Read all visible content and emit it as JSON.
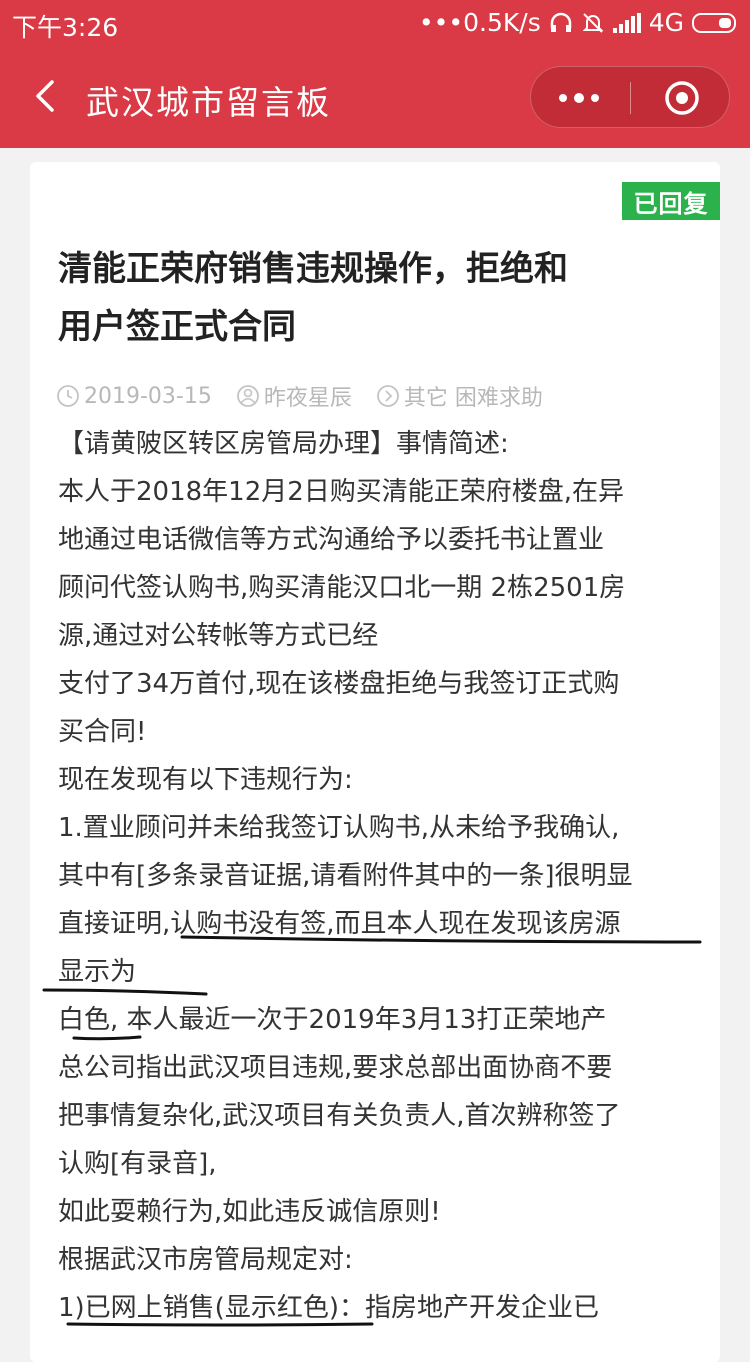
{
  "status_bar": {
    "time": "下午3:26",
    "net_speed": "•••0.5K/s",
    "network": "4G",
    "icons": [
      "headphones-icon",
      "mute-bell-icon",
      "signal-icon",
      "battery-icon"
    ]
  },
  "navbar": {
    "title": "武汉城市留言板",
    "back_icon": "chevron-left-icon",
    "more_icon": "more-dots-icon",
    "close_icon": "target-circle-icon",
    "color": "#d93a45"
  },
  "post": {
    "status_badge": "已回复",
    "badge_color": "#2bb24c",
    "title_lines": [
      "清能正荣府销售违规操作，拒绝和",
      "用户签正式合同"
    ],
    "date": "2019-03-15",
    "author": "昨夜星辰",
    "category": "其它 困难求助",
    "body_lines": [
      "【请黄陂区转区房管局办理】事情简述:",
      "本人于2018年12月2日购买清能正荣府楼盘,在异",
      "地通过电话微信等方式沟通给予以委托书让置业",
      "顾问代签认购书,购买清能汉口北一期 2栋2501房",
      "源,通过对公转帐等方式已经",
      "支付了34万首付,现在该楼盘拒绝与我签订正式购",
      "买合同!",
      "现在发现有以下违规行为:",
      "1.置业顾问并未给我签订认购书,从未给予我确认,",
      "其中有[多条录音证据,请看附件其中的一条]很明显",
      "直接证明,认购书没有签,而且本人现在发现该房源",
      "显示为",
      "  白色, 本人最近一次于2019年3月13打正荣地产",
      "总公司指出武汉项目违规,要求总部出面协商不要",
      "把事情复杂化,武汉项目有关负责人,首次辨称签了",
      "认购[有录音],",
      "  如此耍赖行为,如此违反诚信原则!",
      "  根据武汉市房管局规定对:",
      "  1)已网上销售(显示红色)：指房地产开发企业已"
    ]
  }
}
